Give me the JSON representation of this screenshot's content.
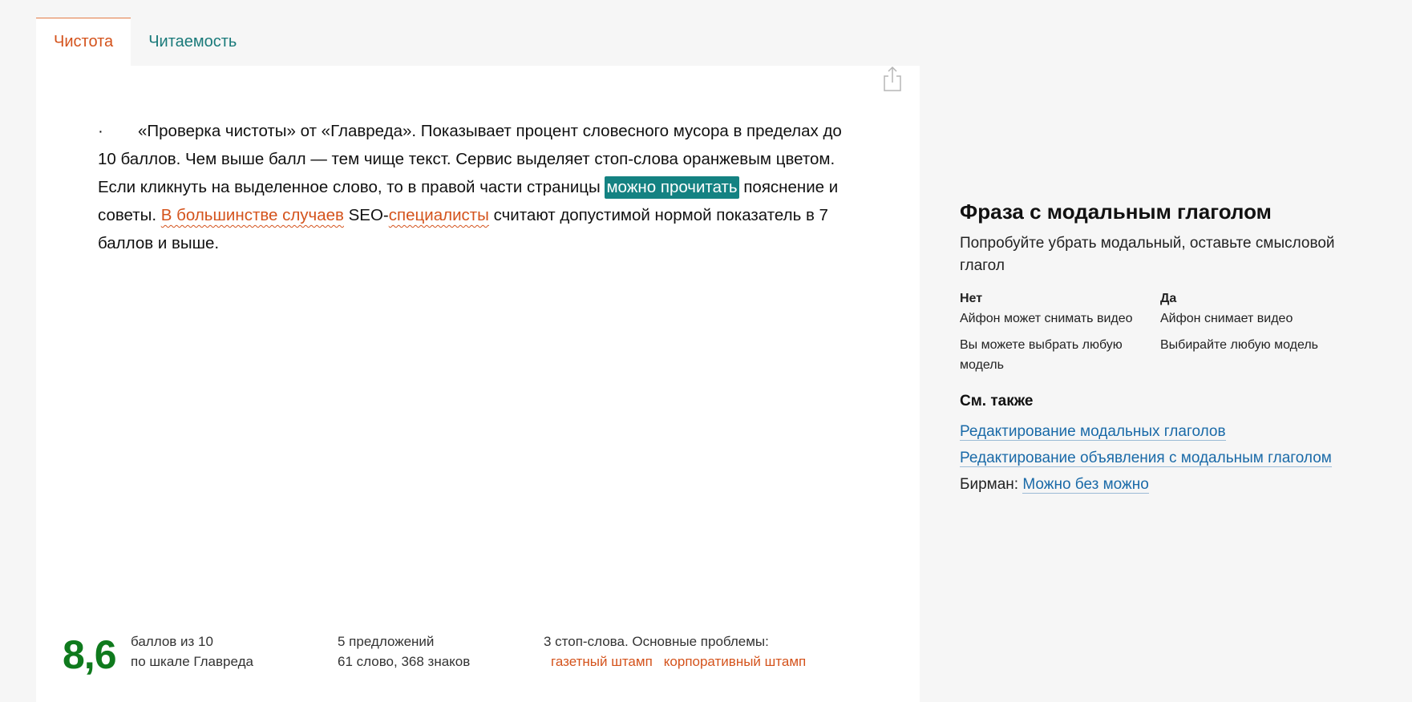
{
  "tabs": [
    {
      "label": "Чистота",
      "active": true
    },
    {
      "label": "Читаемость",
      "active": false
    }
  ],
  "editor": {
    "share_icon": "share-icon",
    "bullet": "·",
    "segments": {
      "s1": "«Проверка чистоты» от «Главреда». Показывает процент словесного мусора в пределах до 10 баллов. Чем выше балл — тем чище текст. Сервис выделяет стоп-слова оранжевым цветом. Если кликнуть на выделенное слово, то в правой части страницы ",
      "active_highlight": "можно прочитать",
      "s2": " пояснение и советы. ",
      "stop1": "В большинстве случаев",
      "s3": " SEO-",
      "stop2": "специалисты",
      "s4": " считают допустимой нормой показатель в 7 баллов и выше."
    }
  },
  "stats": {
    "score": "8,6",
    "score_line1": "баллов из 10",
    "score_line2": "по шкале Главреда",
    "sentences": "5 предложений",
    "words": "61 слово, 368 знаков",
    "stopwords": "3 стоп-слова. Основные проблемы:",
    "problems": [
      "газетный штамп",
      "корпоративный штамп"
    ]
  },
  "sidebar": {
    "title": "Фраза с модальным глаголом",
    "description": "Попробуйте убрать модальный, оставьте смысловой глагол",
    "no_label": "Нет",
    "yes_label": "Да",
    "examples": [
      {
        "no": "Айфон может снимать видео",
        "yes": "Айфон снимает видео"
      },
      {
        "no": "Вы можете выбрать любую модель",
        "yes": "Выбирайте любую модель"
      }
    ],
    "see_also": "См. также",
    "link1": "Редактирование модальных глаголов",
    "link2": "Редактирование объявления с модальным глаголом",
    "birman_prefix": "Бирман: ",
    "link3": "Можно без можно"
  },
  "colors": {
    "accent_orange": "#d4531c",
    "teal": "#148282",
    "score_green": "#0f7a1d",
    "link_blue": "#1a6aa8"
  }
}
